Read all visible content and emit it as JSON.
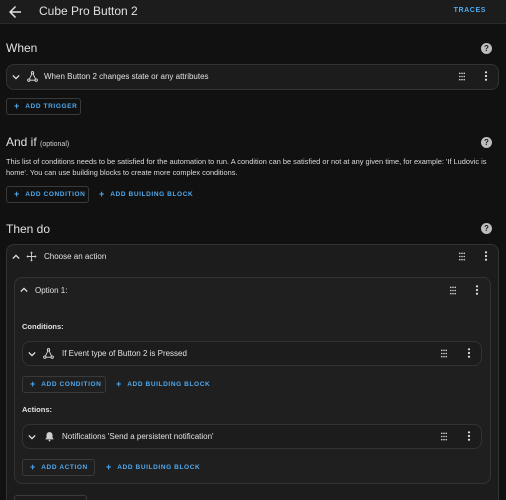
{
  "header": {
    "title": "Cube Pro Button 2",
    "traces_label": "TRACES"
  },
  "when": {
    "title": "When",
    "trigger_text": "When Button 2 changes state or any attributes",
    "add_trigger_label": "ADD TRIGGER"
  },
  "and_if": {
    "title": "And if",
    "optional_label": "(optional)",
    "description": "This list of conditions needs to be satisfied for the automation to run. A condition can be satisfied or not at any given time, for example: 'If Ludovic is home'. You can use building blocks to create more complex conditions.",
    "add_condition_label": "ADD CONDITION",
    "add_building_block_label": "ADD BUILDING BLOCK"
  },
  "then_do": {
    "title": "Then do",
    "action_title": "Choose an action",
    "option_title": "Option 1:",
    "conditions_label": "Conditions:",
    "condition_text": "If Event type of Button 2 is Pressed",
    "add_condition_label": "ADD CONDITION",
    "add_building_block_label": "ADD BUILDING BLOCK",
    "actions_label": "Actions:",
    "action_text": "Notifications 'Send a persistent notification'",
    "add_action_label": "ADD ACTION",
    "add_building_block_label_2": "ADD BUILDING BLOCK"
  },
  "colors": {
    "accent": "#4fa9ef",
    "background": "#111111",
    "card": "#1c1c1c"
  }
}
